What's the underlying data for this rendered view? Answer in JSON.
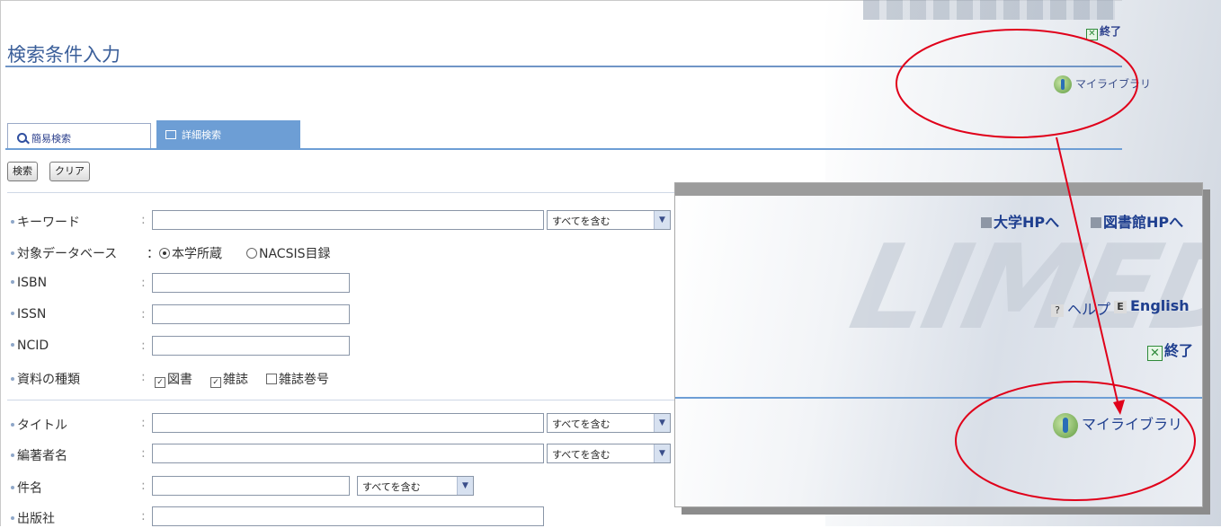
{
  "page": {
    "title": "検索条件入力"
  },
  "header": {
    "exit_label": "終了",
    "mylibrary_label": "マイライブラリ"
  },
  "tabs": [
    {
      "label": "簡易検索",
      "active": false
    },
    {
      "label": "詳細検索",
      "active": true
    }
  ],
  "toolbar": {
    "search_label": "検索",
    "clear_label": "クリア"
  },
  "form": {
    "keyword": {
      "label": "キーワード",
      "value": "",
      "match": "すべてを含む"
    },
    "database": {
      "label": "対象データベース",
      "options": [
        {
          "label": "本学所蔵",
          "selected": true
        },
        {
          "label": "NACSIS目録",
          "selected": false
        }
      ]
    },
    "isbn": {
      "label": "ISBN",
      "value": ""
    },
    "issn": {
      "label": "ISSN",
      "value": ""
    },
    "ncid": {
      "label": "NCID",
      "value": ""
    },
    "material_type": {
      "label": "資料の種類",
      "options": [
        {
          "label": "図書",
          "checked": true
        },
        {
          "label": "雑誌",
          "checked": true
        },
        {
          "label": "雑誌巻号",
          "checked": false
        }
      ]
    },
    "title": {
      "label": "タイトル",
      "value": "",
      "match": "すべてを含む"
    },
    "author": {
      "label": "編著者名",
      "value": "",
      "match": "すべてを含む"
    },
    "subject": {
      "label": "件名",
      "value": "",
      "match": "すべてを含む"
    },
    "publisher": {
      "label": "出版社",
      "value": ""
    }
  },
  "zoom_panel": {
    "university_hp": "大学HPへ",
    "library_hp": "図書館HPへ",
    "help_label": "ヘルプ",
    "english_label": "English",
    "help_badge": "?",
    "english_badge": "E",
    "exit_label": "終了",
    "mylibrary_label": "マイライブラリ",
    "brand_text": "LIMEDIO"
  },
  "colors": {
    "accent": "#6d9ed5",
    "link": "#1f3f8f",
    "annotation": "#e0001a"
  }
}
